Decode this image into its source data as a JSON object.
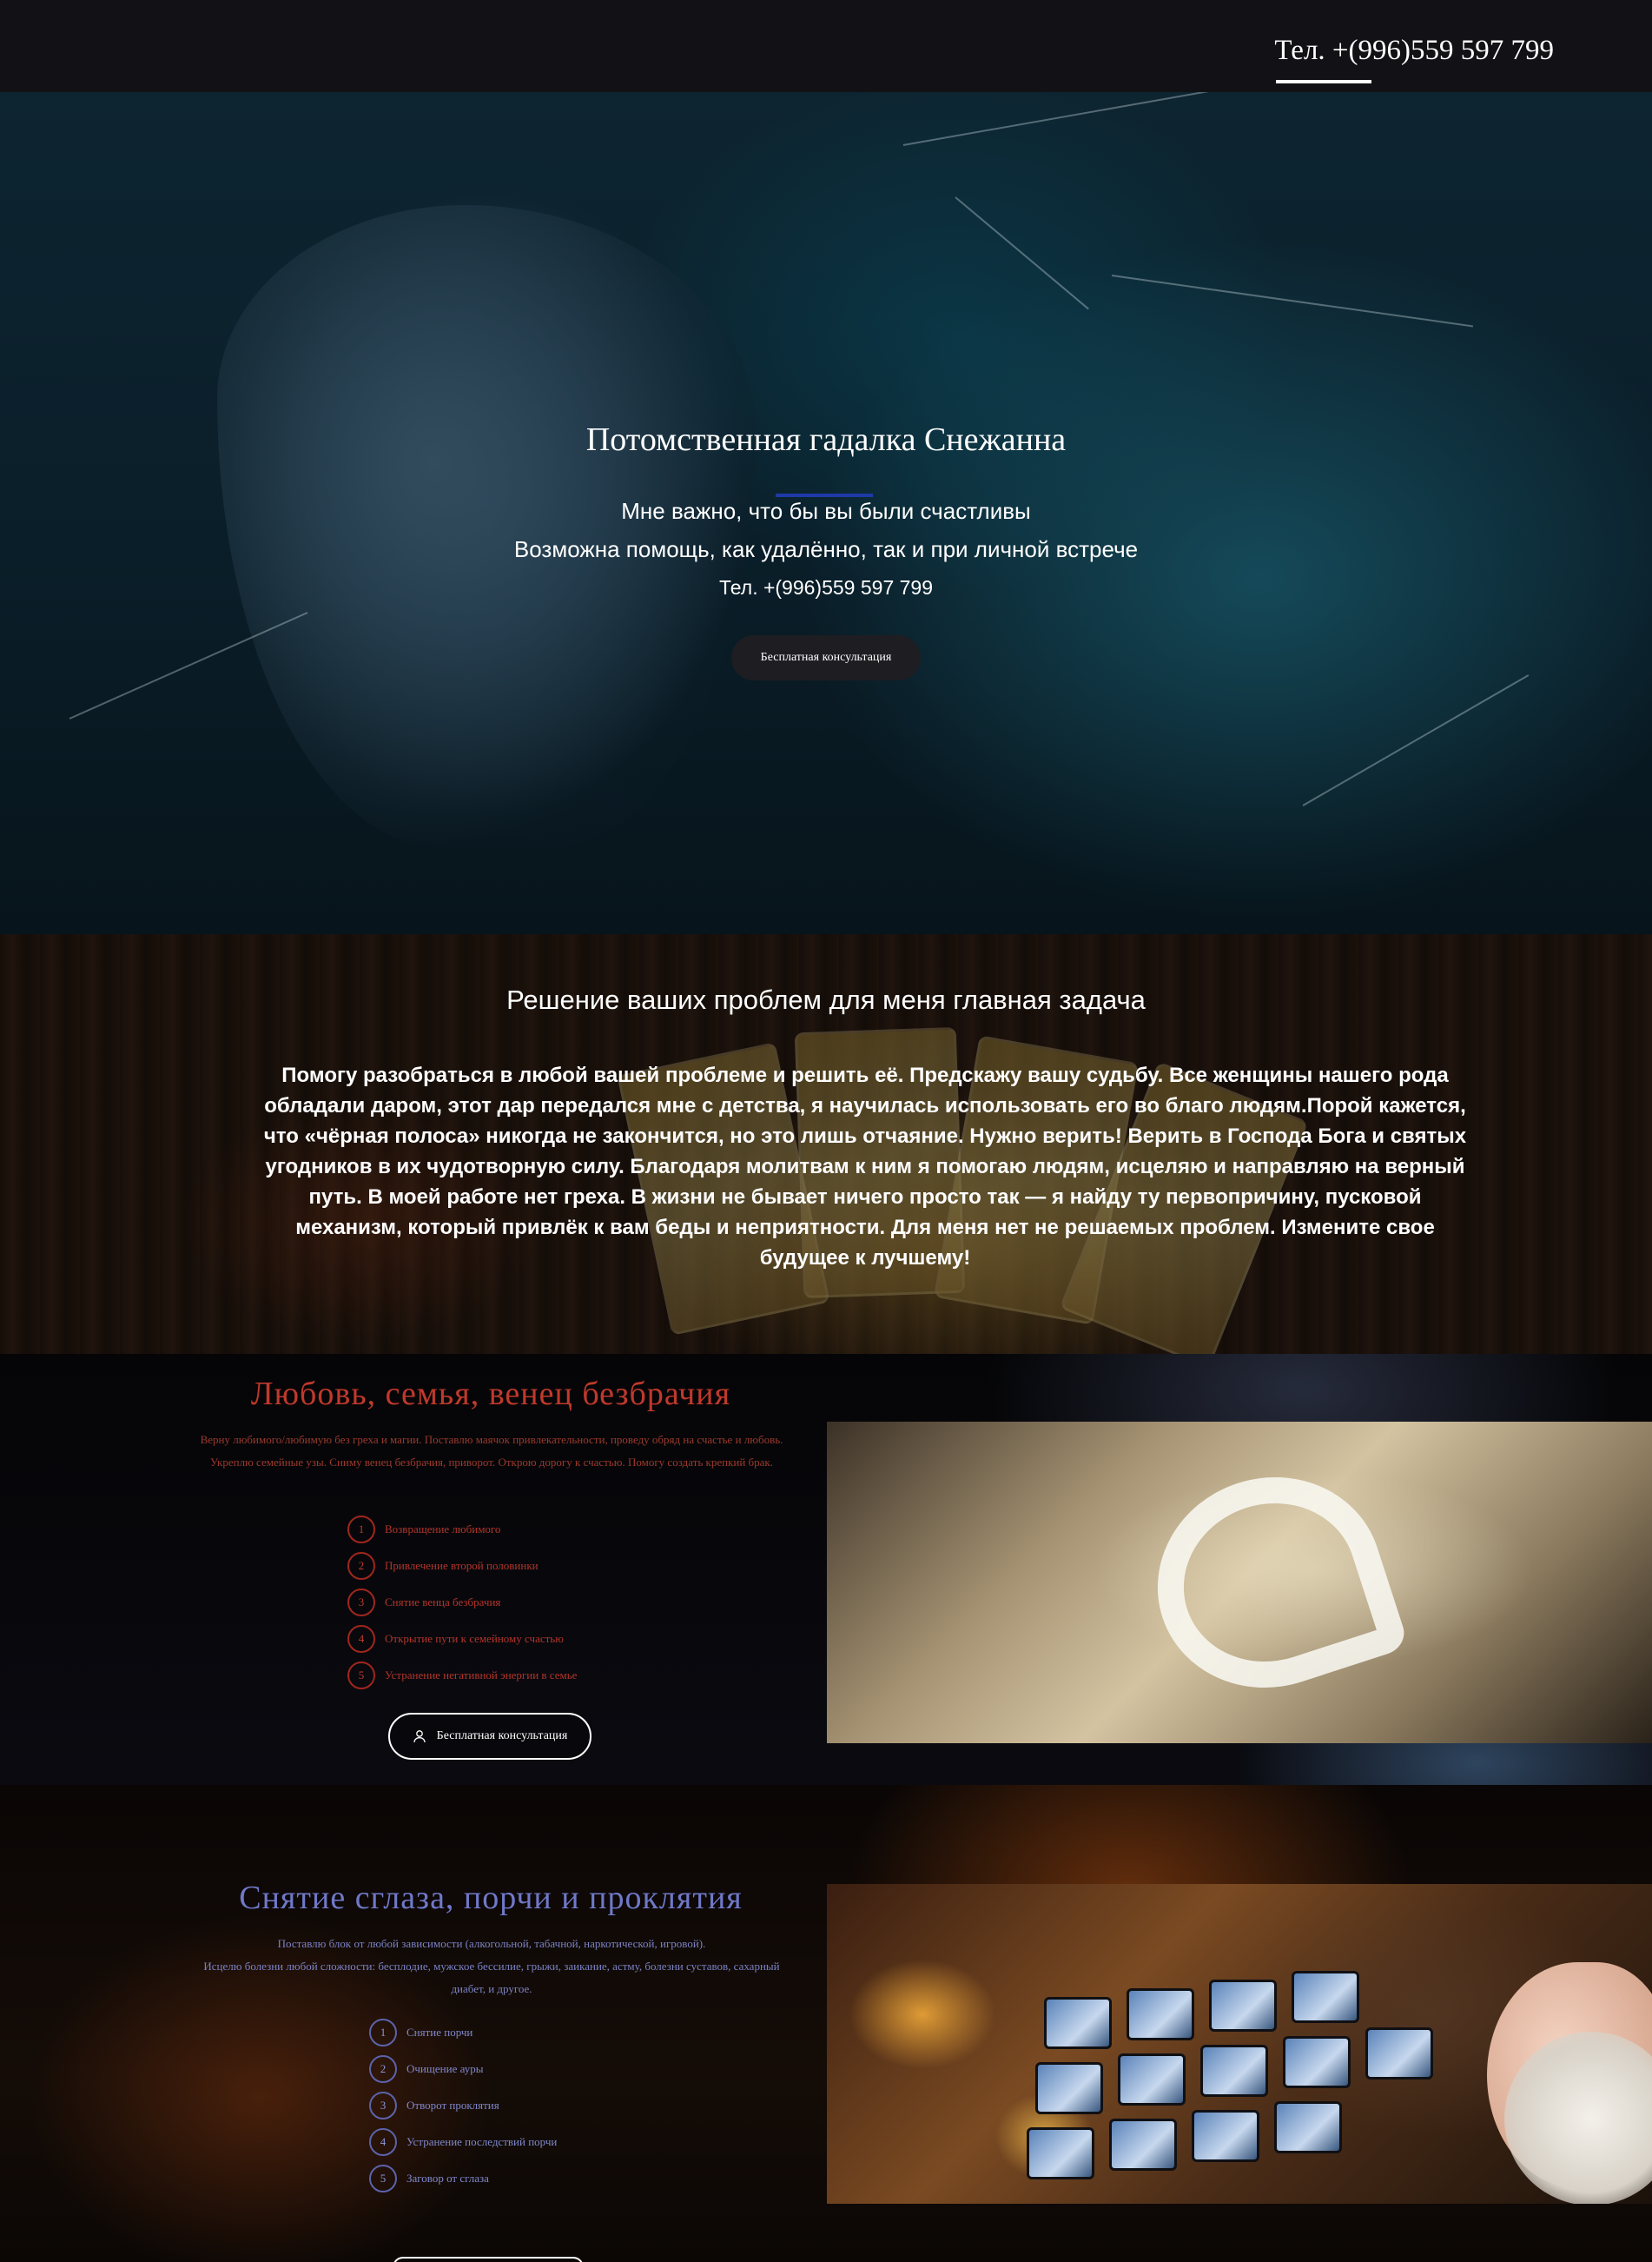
{
  "header": {
    "phone": "Тел. +(996)559 597 799"
  },
  "hero": {
    "title": "Потомственная гадалка Снежанна",
    "line1": "Мне важно, что бы вы были счастливы",
    "line2": "Возможна помощь, как удалённо, так и при личной встрече",
    "phone": "Тел. +(996)559 597 799",
    "button_label": "Бесплатная консультация"
  },
  "about": {
    "title": "Решение ваших проблем для меня главная задача",
    "text": "Помогу разобраться в любой вашей проблеме и решить её. Предскажу вашу судьбу. Все женщины нашего рода обладали даром, этот дар передался мне с детства, я научилась использовать его во благо людям.Порой кажется, что «чёрная полоса» никогда не закончится, но это лишь отчаяние. Нужно верить! Верить в Господа Бога и святых угодников в их чудотворную силу. Благодаря молитвам к ним я помогаю людям, исцеляю и направляю на верный путь. В моей работе нет греха. В жизни не бывает ничего просто так — я найду ту первопричину, пусковой механизм, который привлёк к вам беды и неприятности. Для меня нет не решаемых проблем. Измените свое будущее к лучшему!"
  },
  "love": {
    "title": "Любовь, семья, венец безбрачия",
    "description": "Верну любимого/любимую без греха и магии. Поставлю маячок привлекательности, проведу обряд на счастье и любовь. Укреплю семейные узы. Сниму венец безбрачия, приворот. Открою дорогу к счастью. Помогу создать крепкий брак.",
    "items": [
      {
        "num": "1",
        "label": "Возвращение любимого"
      },
      {
        "num": "2",
        "label": "Привлечение второй половинки"
      },
      {
        "num": "3",
        "label": "Снятие венца безбрачия"
      },
      {
        "num": "4",
        "label": "Открытие пути к семейному счастью"
      },
      {
        "num": "5",
        "label": "Устранение негативной энергии в семье"
      }
    ],
    "button_label": "Бесплатная консультация",
    "accent": "#c0392b"
  },
  "curse": {
    "title": "Снятие сглаза, порчи и проклятия",
    "description_line1": "Поставлю блок от любой зависимости (алкогольной, табачной, наркотической, игровой).",
    "description_line2": "Исцелю болезни любой сложности:  бесплодие, мужское бессилие, грыжи, заикание, астму, болезни суставов, сахарный диабет, и другое.",
    "items": [
      {
        "num": "1",
        "label": "Снятие порчи"
      },
      {
        "num": "2",
        "label": "Очищение ауры"
      },
      {
        "num": "3",
        "label": "Отворот проклятия"
      },
      {
        "num": "4",
        "label": "Устранение последствий порчи"
      },
      {
        "num": "5",
        "label": "Заговор от сглаза"
      }
    ],
    "accent": "#6f79c9"
  },
  "icons": {
    "button_icon": "user-icon"
  }
}
